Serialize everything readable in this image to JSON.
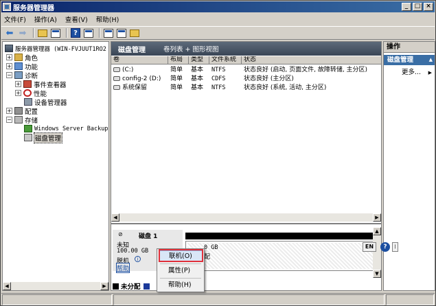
{
  "window": {
    "title": "服务器管理器"
  },
  "menu": [
    "文件(F)",
    "操作(A)",
    "查看(V)",
    "帮助(H)"
  ],
  "tree": {
    "root": "服务器管理器 (WIN-FVJUUT1RO2",
    "roles": "角色",
    "features": "功能",
    "diagnostics": "诊断",
    "event_viewer": "事件查看器",
    "performance": "性能",
    "device_manager": "设备管理器",
    "configuration": "配置",
    "storage": "存储",
    "windows_server_backup": "Windows Server Backup",
    "disk_management": "磁盘管理"
  },
  "center": {
    "header_title": "磁盘管理",
    "header_view": "卷列表 + 图形视图",
    "columns": [
      "卷",
      "布局",
      "类型",
      "文件系统",
      "状态"
    ],
    "rows": [
      {
        "volume": "(C:)",
        "layout": "简单",
        "type": "基本",
        "fs": "NTFS",
        "status": "状态良好 (启动, 页面文件, 故障转储, 主分区)"
      },
      {
        "volume": "config-2 (D:)",
        "layout": "简单",
        "type": "基本",
        "fs": "CDFS",
        "status": "状态良好 (主分区)"
      },
      {
        "volume": "系统保留",
        "layout": "简单",
        "type": "基本",
        "fs": "NTFS",
        "status": "状态良好 (系统, 活动, 主分区)"
      }
    ],
    "disk": {
      "name": "磁盘 1",
      "kind": "未知",
      "size": "100.00 GB",
      "state": "脱机",
      "help": "帮助",
      "area_size": "0 GB",
      "area_state": "配"
    },
    "legend": {
      "unallocated": "未分配"
    }
  },
  "actions": {
    "header": "操作",
    "section": "磁盘管理",
    "more": "更多..."
  },
  "ime": {
    "lang": "EN",
    "help": "?",
    "opt": "⁞"
  },
  "context_menu": {
    "online": "联机(O)",
    "properties": "属性(P)",
    "help": "帮助(H)"
  },
  "colors": {
    "title_start": "#0a246a",
    "title_end": "#3a6ea5",
    "highlight_border": "#e0303a",
    "actions_accent": "#3a6ea5"
  }
}
